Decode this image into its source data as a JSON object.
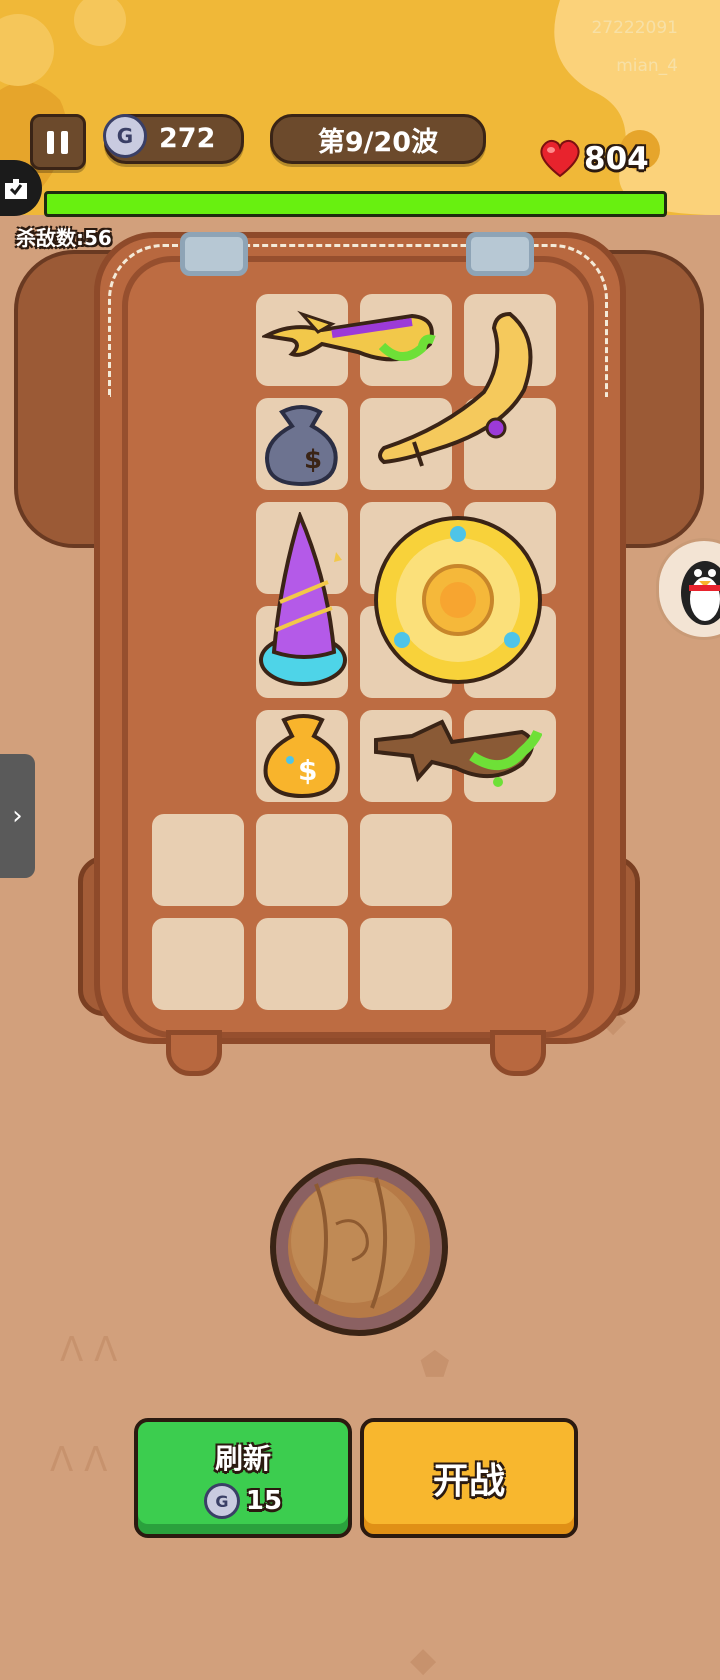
{
  "watermark": {
    "id": "27222091",
    "user": "mian_4"
  },
  "hud": {
    "coins": "272",
    "wave": "第9/20波",
    "hp": "804",
    "kills": "杀敌数:56",
    "hp_fraction": 1.0
  },
  "inventory": {
    "items": [
      {
        "name": "green-slime-sword",
        "icon": "sword-icon"
      },
      {
        "name": "golden-boomerang",
        "icon": "boomerang-icon"
      },
      {
        "name": "gray-money-bag",
        "icon": "money-bag-icon"
      },
      {
        "name": "purple-wizard-hat",
        "icon": "wizard-hat-icon"
      },
      {
        "name": "golden-shield",
        "icon": "shield-icon"
      },
      {
        "name": "gold-money-bag",
        "icon": "money-bag-icon"
      },
      {
        "name": "wooden-slime-sword",
        "icon": "sword-icon"
      }
    ]
  },
  "buttons": {
    "refresh_label": "刷新",
    "refresh_cost": "15",
    "fight_label": "开战"
  },
  "colors": {
    "hp_bar": "#68f010",
    "refresh_button": "#3ccd4f",
    "fight_button": "#f8b72e"
  }
}
